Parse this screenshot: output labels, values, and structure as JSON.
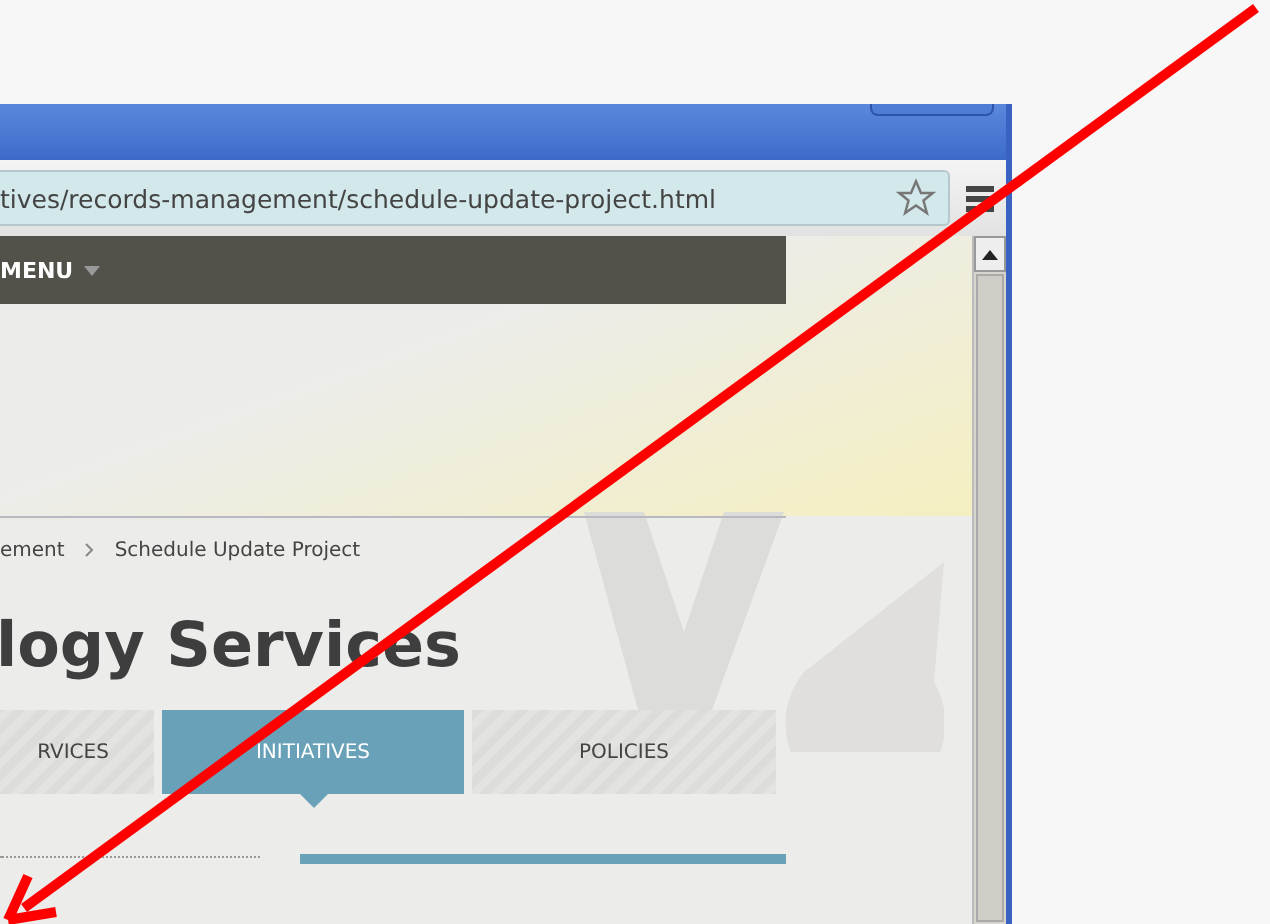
{
  "browser": {
    "url": "tives/records-management/schedule-update-project.html"
  },
  "site_menu": {
    "label": "MENU"
  },
  "breadcrumb": [
    {
      "label": "ement"
    },
    {
      "label": "Schedule Update Project"
    }
  ],
  "page_title": "logy Services",
  "tabs": [
    {
      "label": "RVICES",
      "selected": false
    },
    {
      "label": "INITIATIVES",
      "selected": true
    },
    {
      "label": "POLICIES",
      "selected": false
    }
  ]
}
